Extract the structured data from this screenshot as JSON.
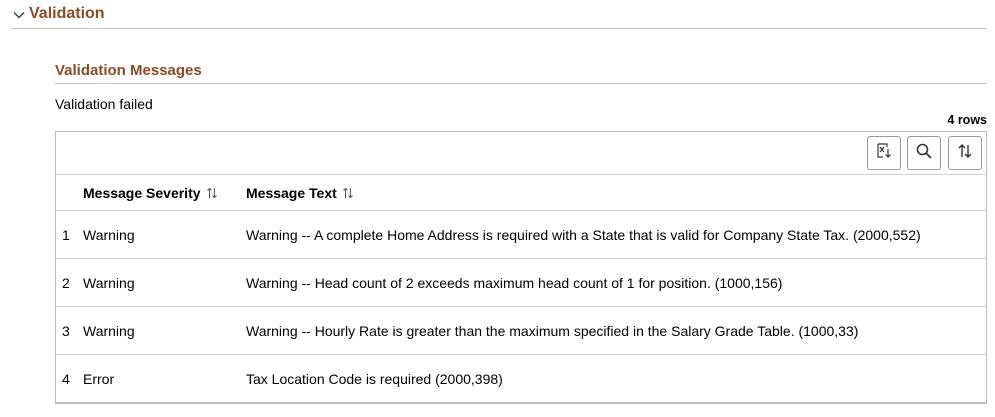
{
  "section": {
    "title": "Validation",
    "icon": "chevron-down-icon"
  },
  "messages": {
    "title": "Validation Messages",
    "status": "Validation failed",
    "row_count": "4 rows",
    "toolbar": {
      "export_icon": "export-to-excel-icon",
      "search_icon": "search-icon",
      "sort_icon": "sort-icon"
    },
    "columns": [
      {
        "label": "Message Severity"
      },
      {
        "label": "Message Text"
      }
    ],
    "rows": [
      {
        "num": "1",
        "severity": "Warning",
        "text": "Warning -- A complete Home Address is required with a State that is valid for Company State Tax. (2000,552)"
      },
      {
        "num": "2",
        "severity": "Warning",
        "text": "Warning -- Head count of 2 exceeds maximum head count of 1 for position. (1000,156)"
      },
      {
        "num": "3",
        "severity": "Warning",
        "text": "Warning -- Hourly Rate is greater than the maximum specified in the Salary Grade Table. (1000,33)"
      },
      {
        "num": "4",
        "severity": "Error",
        "text": "Tax Location Code is required (2000,398)"
      }
    ]
  },
  "colors": {
    "accent": "#8c4b23",
    "border": "#c7c7c7"
  }
}
